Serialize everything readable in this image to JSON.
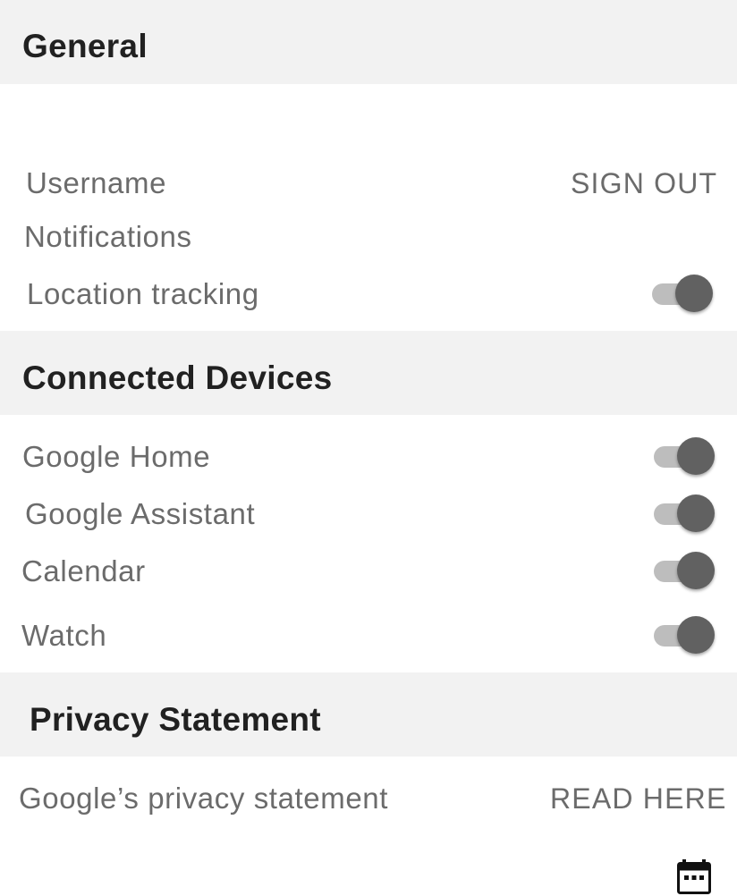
{
  "sections": {
    "general": {
      "title": "General",
      "username_label": "Username",
      "sign_out_label": "SIGN OUT",
      "notifications_label": "Notifications",
      "location_label": "Location tracking",
      "location_enabled": true
    },
    "connected_devices": {
      "title": "Connected Devices",
      "items": [
        {
          "label": "Google Home",
          "enabled": true
        },
        {
          "label": "Google Assistant",
          "enabled": true
        },
        {
          "label": "Calendar",
          "enabled": true
        },
        {
          "label": "Watch",
          "enabled": true
        }
      ]
    },
    "privacy": {
      "title": "Privacy Statement",
      "statement_label": "Google’s privacy statement",
      "read_here_label": "READ HERE"
    }
  },
  "icons": {
    "toggle_thumb_color": "#616161",
    "toggle_track_color": "#bdbdbd",
    "footer_icon": "calendar-icon"
  }
}
